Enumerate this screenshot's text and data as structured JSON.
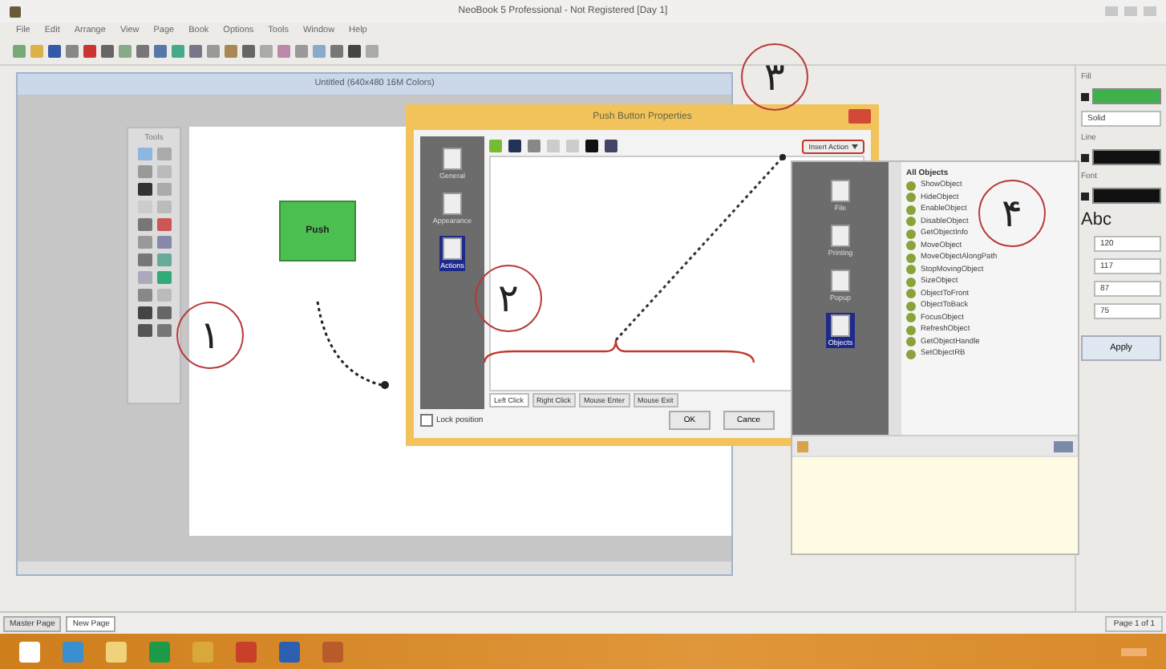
{
  "window": {
    "title": "NeoBook 5 Professional - Not Registered [Day 1]"
  },
  "menu": [
    "File",
    "Edit",
    "Arrange",
    "View",
    "Page",
    "Book",
    "Options",
    "Tools",
    "Window",
    "Help"
  ],
  "canvas_window": {
    "title": "Untitled (640x480 16M Colors)",
    "tools_title": "Tools",
    "button_label": "Push"
  },
  "dialog": {
    "title": "Push Button Properties",
    "sections": [
      {
        "label": "General",
        "selected": false
      },
      {
        "label": "Appearance",
        "selected": false
      },
      {
        "label": "Actions",
        "selected": true
      }
    ],
    "insert_action": "Insert Action",
    "events": [
      {
        "label": "Left Click",
        "selected": true
      },
      {
        "label": "Right Click",
        "selected": false
      },
      {
        "label": "Mouse Enter",
        "selected": false
      },
      {
        "label": "Mouse Exit",
        "selected": false
      }
    ],
    "lock_position": {
      "label": "Lock position",
      "checked": false
    },
    "buttons": [
      "OK",
      "Cance"
    ]
  },
  "action_panel": {
    "categories": [
      {
        "label": "File",
        "selected": false
      },
      {
        "label": "Printing",
        "selected": false
      },
      {
        "label": "Popup",
        "selected": false
      },
      {
        "label": "Objects",
        "selected": true
      }
    ],
    "group": "All Objects",
    "actions": [
      "ShowObject",
      "HideObject",
      "EnableObject",
      "DisableObject",
      "GetObjectInfo",
      "MoveObject",
      "MoveObjectAlongPath",
      "StopMovingObject",
      "SizeObject",
      "ObjectToFront",
      "ObjectToBack",
      "FocusObject",
      "RefreshObject",
      "GetObjectHandle",
      "SetObjectRB"
    ]
  },
  "properties_panel": {
    "fill_label": "Fill",
    "style": "Solid",
    "line_label": "Line",
    "font_label": "Font",
    "font_sample": "Abc",
    "fields": [
      "120",
      "117",
      "87",
      "75"
    ],
    "apply": "Apply"
  },
  "annotations": [
    "۱",
    "۲",
    "۳",
    "۴"
  ],
  "status_bar": {
    "tabs": [
      {
        "label": "Master Page",
        "selected": false
      },
      {
        "label": "New Page",
        "selected": true
      }
    ],
    "page": "Page 1 of 1"
  }
}
